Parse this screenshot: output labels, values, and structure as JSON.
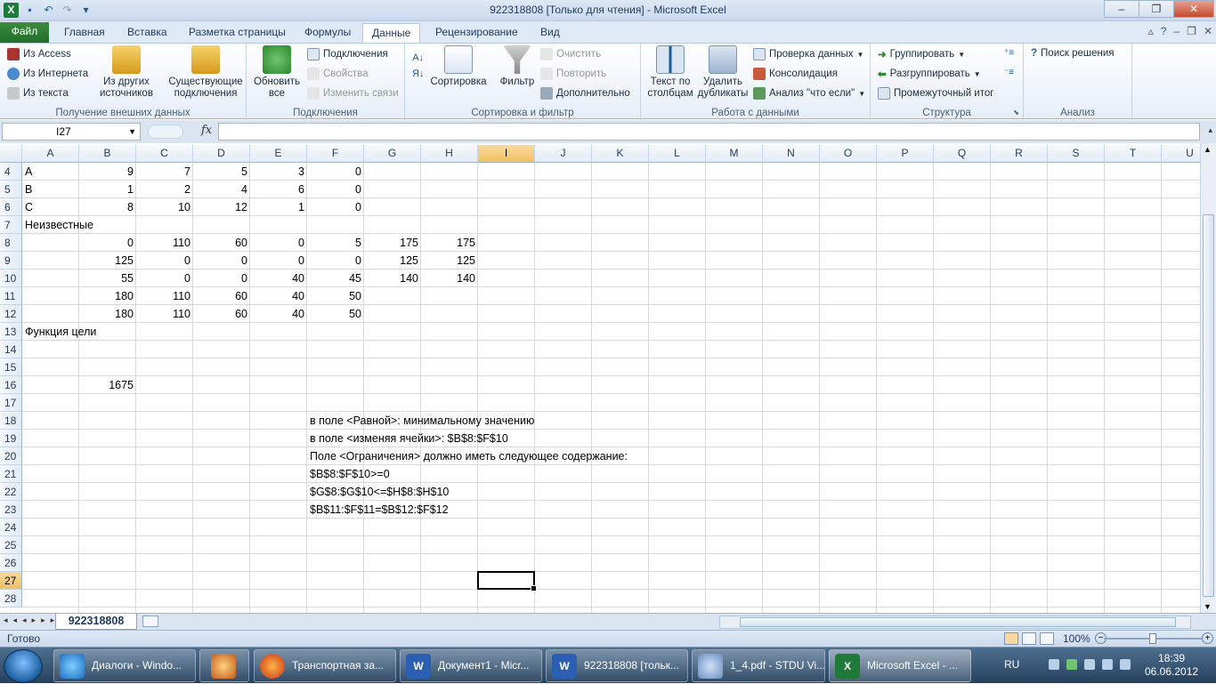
{
  "window": {
    "title": "922318808  [Только для чтения]  -  Microsoft Excel"
  },
  "tabs": [
    "Главная",
    "Вставка",
    "Разметка страницы",
    "Формулы",
    "Данные",
    "Рецензирование",
    "Вид"
  ],
  "file_tab": "Файл",
  "active_tab": "Данные",
  "ribbon": {
    "ext": {
      "access": "Из Access",
      "web": "Из Интернета",
      "text": "Из текста",
      "other": "Из других источников",
      "existing": "Существующие подключения",
      "caption": "Получение внешних данных"
    },
    "conn": {
      "refresh": "Обновить все",
      "connections": "Подключения",
      "properties": "Свойства",
      "edit_links": "Изменить связи",
      "caption": "Подключения"
    },
    "sort": {
      "sort": "Сортировка",
      "filter": "Фильтр",
      "clear": "Очистить",
      "reapply": "Повторить",
      "advanced": "Дополнительно",
      "caption": "Сортировка и фильтр"
    },
    "tools": {
      "text_to_cols": "Текст по столбцам",
      "remove_dup": "Удалить дубликаты",
      "validation": "Проверка данных",
      "consolidate": "Консолидация",
      "whatif": "Анализ \"что если\"",
      "caption": "Работа с данными"
    },
    "outline": {
      "group": "Группировать",
      "ungroup": "Разгруппировать",
      "subtotal": "Промежуточный итог",
      "caption": "Структура"
    },
    "analysis": {
      "solver": "Поиск решения",
      "caption": "Анализ"
    }
  },
  "formula_bar": {
    "name_box": "I27",
    "fx": "fx",
    "value": ""
  },
  "columns": [
    "A",
    "B",
    "C",
    "D",
    "E",
    "F",
    "G",
    "H",
    "I",
    "J",
    "K",
    "L",
    "M",
    "N",
    "O",
    "P",
    "Q",
    "R",
    "S",
    "T",
    "U"
  ],
  "selected_column": "I",
  "rows": [
    "4",
    "5",
    "6",
    "7",
    "8",
    "9",
    "10",
    "11",
    "12",
    "13",
    "14",
    "15",
    "16",
    "17",
    "18",
    "19",
    "20",
    "21",
    "22",
    "23",
    "24",
    "25",
    "26",
    "27",
    "28"
  ],
  "selected_row": "27",
  "cells": {
    "r4": {
      "A": "A",
      "B": "9",
      "C": "7",
      "D": "5",
      "E": "3",
      "F": "0"
    },
    "r5": {
      "A": "B",
      "B": "1",
      "C": "2",
      "D": "4",
      "E": "6",
      "F": "0"
    },
    "r6": {
      "A": "C",
      "B": "8",
      "C": "10",
      "D": "12",
      "E": "1",
      "F": "0"
    },
    "r7": {
      "A": "Неизвестные"
    },
    "r8": {
      "B": "0",
      "C": "110",
      "D": "60",
      "E": "0",
      "F": "5",
      "G": "175",
      "H": "175"
    },
    "r9": {
      "B": "125",
      "C": "0",
      "D": "0",
      "E": "0",
      "F": "0",
      "G": "125",
      "H": "125"
    },
    "r10": {
      "B": "55",
      "C": "0",
      "D": "0",
      "E": "40",
      "F": "45",
      "G": "140",
      "H": "140"
    },
    "r11": {
      "B": "180",
      "C": "110",
      "D": "60",
      "E": "40",
      "F": "50"
    },
    "r12": {
      "B": "180",
      "C": "110",
      "D": "60",
      "E": "40",
      "F": "50"
    },
    "r13": {
      "A": "Функция цели"
    },
    "r16": {
      "B": "1675"
    },
    "r18": {
      "F": "в поле <Равной>: минимальному значению"
    },
    "r19": {
      "F": "в поле <изменяя ячейки>: $B$8:$F$10"
    },
    "r20": {
      "F": "Поле <Ограничения> должно иметь следующее содержание:"
    },
    "r21": {
      "F": "$B$8:$F$10>=0"
    },
    "r22": {
      "F": "$G$8:$G$10<=$H$8:$H$10"
    },
    "r23": {
      "F": "$B$11:$F$11=$B$12:$F$12"
    }
  },
  "sheet_tab": "922318808",
  "status": {
    "ready": "Готово",
    "zoom": "100%"
  },
  "taskbar": {
    "items": [
      "Диалоги - Windo...",
      "",
      "Транспортная за...",
      "Документ1 - Micr...",
      "922318808 [тольк...",
      "1_4.pdf - STDU Vi...",
      "Microsoft Excel - ..."
    ],
    "lang": "RU",
    "time": "18:39",
    "date": "06.06.2012"
  }
}
